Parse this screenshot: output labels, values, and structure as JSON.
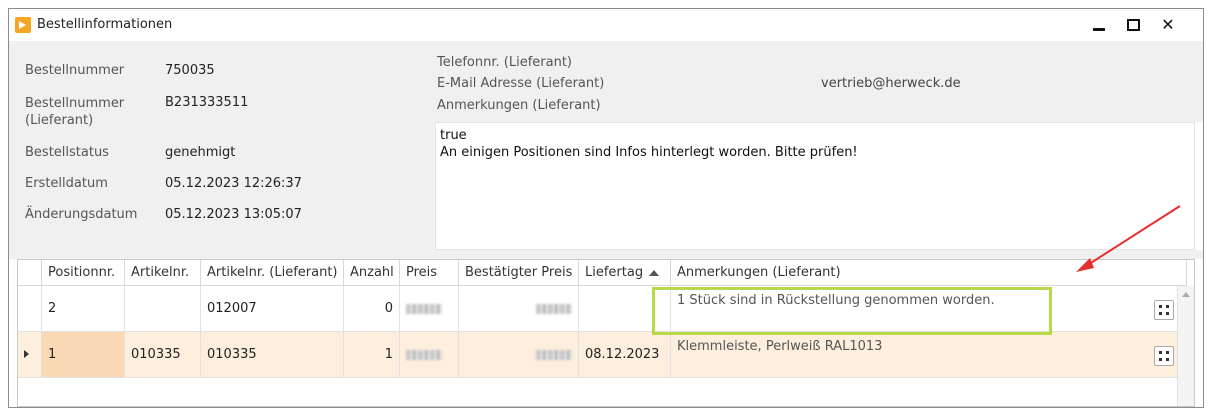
{
  "window": {
    "title": "Bestellinformationen"
  },
  "order": {
    "fields": [
      {
        "label": "Bestellnummer",
        "value": "750035"
      },
      {
        "label": "Bestellnummer\n(Lieferant)",
        "value": "B231333511"
      },
      {
        "label": "Bestellstatus",
        "value": "genehmigt"
      },
      {
        "label": "Erstelldatum",
        "value": "05.12.2023 12:26:37"
      },
      {
        "label": "Änderungsdatum",
        "value": "05.12.2023 13:05:07"
      }
    ]
  },
  "supplier": {
    "phone_label": "Telefonnr. (Lieferant)",
    "phone_value": "",
    "email_label": "E-Mail Adresse (Lieferant)",
    "email_value": "vertrieb@herweck.de",
    "notes_label": "Anmerkungen (Lieferant)",
    "notes_text": "true\nAn einigen Positionen sind Infos hinterlegt worden. Bitte prüfen!"
  },
  "grid": {
    "headers": [
      "Positionnr.",
      "Artikelnr.",
      "Artikelnr. (Lieferant)",
      "Anzahl",
      "Preis",
      "Bestätigter Preis",
      "Liefertag",
      "Anmerkungen (Lieferant)"
    ],
    "rows": [
      {
        "position": "2",
        "article": "",
        "supplier_article": "012007",
        "quantity": "0",
        "price": "",
        "confirmed_price": "",
        "delivery_day": "",
        "notes": "1 Stück sind in Rückstellung genommen worden."
      },
      {
        "position": "1",
        "article": "010335",
        "supplier_article": "010335",
        "quantity": "1",
        "price": "",
        "confirmed_price": "",
        "delivery_day": "08.12.2023",
        "notes": "Klemmleiste, Perlweiß RAL1013"
      }
    ]
  },
  "colors": {
    "highlight_border": "#b8d94a",
    "arrow": "#e53030",
    "selected_row": "#fdeedd"
  }
}
